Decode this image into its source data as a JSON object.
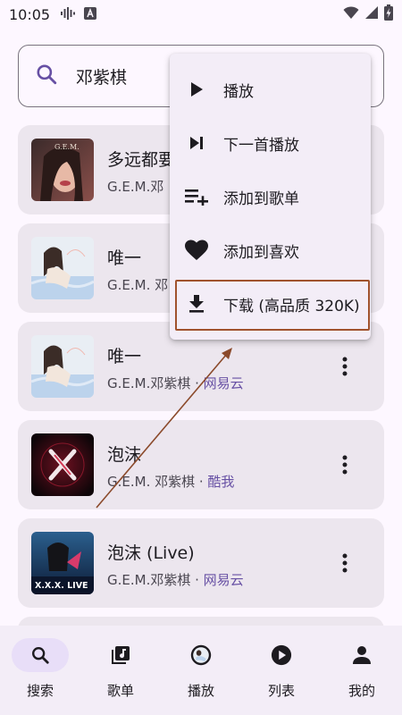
{
  "status_bar": {
    "time": "10:05",
    "icons": [
      "voice-wave-icon",
      "font-a-icon",
      "wifi-icon",
      "signal-icon",
      "battery-charging-icon"
    ]
  },
  "search": {
    "query": "邓紫棋",
    "icon": "search-icon"
  },
  "songs": [
    {
      "title": "多远都要",
      "artist": "G.E.M.邓",
      "source": ""
    },
    {
      "title": "唯一",
      "artist": "G.E.M. 邓",
      "source": ""
    },
    {
      "title": "唯一",
      "artist": "G.E.M.邓紫棋 · ",
      "source": "网易云"
    },
    {
      "title": "泡沫",
      "artist": "G.E.M. 邓紫棋 · ",
      "source": "酷我"
    },
    {
      "title": "泡沫 (Live)",
      "artist": "G.E.M.邓紫棋 · ",
      "source": "网易云"
    }
  ],
  "cover_texts": {
    "live_cover": "X.X.X. LIVE",
    "gem": "G.E.M."
  },
  "menu": {
    "items": [
      {
        "label": "播放",
        "icon": "play-icon"
      },
      {
        "label": "下一首播放",
        "icon": "skip-next-icon"
      },
      {
        "label": "添加到歌单",
        "icon": "playlist-add-icon"
      },
      {
        "label": "添加到喜欢",
        "icon": "heart-icon"
      },
      {
        "label": "下载 (高品质 320K)",
        "icon": "download-icon"
      }
    ]
  },
  "bottom_nav": {
    "items": [
      {
        "label": "搜索",
        "icon": "search-icon",
        "active": true
      },
      {
        "label": "歌单",
        "icon": "music-library-icon",
        "active": false
      },
      {
        "label": "播放",
        "icon": "album-art-icon",
        "active": false
      },
      {
        "label": "列表",
        "icon": "play-circle-icon",
        "active": false
      },
      {
        "label": "我的",
        "icon": "person-icon",
        "active": false
      }
    ]
  },
  "colors": {
    "background": "#fdf7ff",
    "card": "#ece6ee",
    "menu": "#f3edf7",
    "accent": "#6750a4",
    "highlight_border": "#a0522d",
    "arrow": "#8b4a2b"
  }
}
